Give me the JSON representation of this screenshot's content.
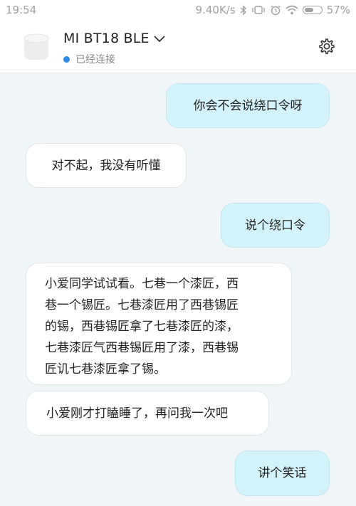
{
  "status_bar": {
    "time": "19:54",
    "network_speed": "9.40K/s",
    "battery_percent": "57%",
    "battery_level": 0.57,
    "icons": [
      "bluetooth-icon",
      "vibrate-icon",
      "alarm-icon",
      "wifi-icon",
      "battery-icon"
    ]
  },
  "header": {
    "device_name": "MI BT18 BLE",
    "connection_status": "已经连接",
    "status_color": "#2c8ce8",
    "icons": [
      "speaker-icon",
      "chevron-down-icon",
      "gear-icon"
    ]
  },
  "chat": {
    "messages": [
      {
        "sender": "user",
        "text": "你会不会说绕口令呀"
      },
      {
        "sender": "assistant",
        "text": "对不起，我没有听懂"
      },
      {
        "sender": "user",
        "text": "说个绕口令"
      },
      {
        "sender": "assistant",
        "lines": [
          "小爱同学试试看。七巷一个漆匠，西",
          "巷一个锡匠。七巷漆匠用了西巷锡匠",
          "的锡，西巷锡匠拿了七巷漆匠的漆，",
          "七巷漆匠气西巷锡匠用了漆，西巷锡",
          "匠讥七巷漆匠拿了锡。"
        ]
      },
      {
        "sender": "assistant",
        "text": "小爱刚才打瞌睡了，再问我一次吧"
      },
      {
        "sender": "user",
        "text": "讲个笑话"
      }
    ],
    "colors": {
      "user_bubble": "#d3f3fb",
      "assistant_bubble": "#ffffff",
      "background": "#f0f5f8"
    }
  }
}
